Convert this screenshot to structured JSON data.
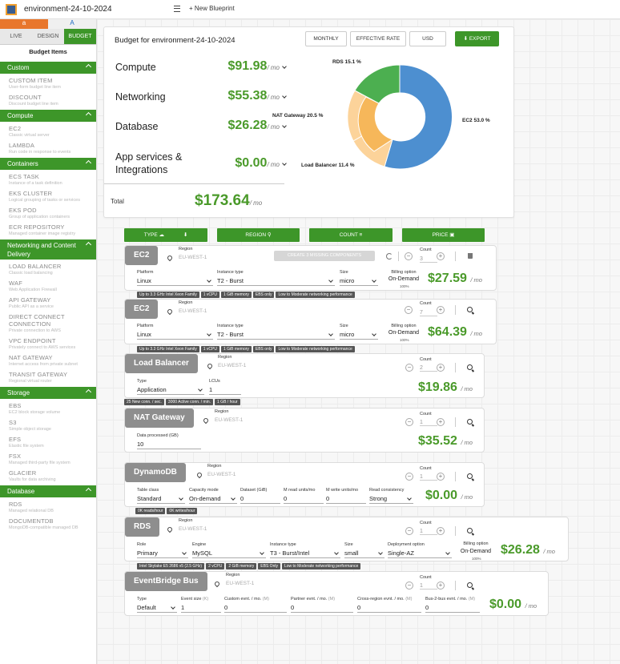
{
  "topbar": {
    "title": "environment-24-10-2024",
    "new_blueprint": "+ New Blueprint"
  },
  "sidebar": {
    "cloud_tabs": [
      "a",
      "A"
    ],
    "mode_tabs": [
      "LIVE",
      "DESIGN",
      "BUDGET"
    ],
    "title": "Budget Items",
    "groups": [
      {
        "label": "Custom",
        "items": [
          {
            "name": "CUSTOM ITEM",
            "desc": "User-form budget line item"
          },
          {
            "name": "DISCOUNT",
            "desc": "Discount budget line item"
          }
        ]
      },
      {
        "label": "Compute",
        "items": [
          {
            "name": "EC2",
            "desc": "Classic virtual server"
          },
          {
            "name": "LAMBDA",
            "desc": "Run code in response to events"
          }
        ]
      },
      {
        "label": "Containers",
        "items": [
          {
            "name": "ECS TASK",
            "desc": "Instance of a task definition"
          },
          {
            "name": "EKS CLUSTER",
            "desc": "Logical grouping of tasks or services"
          },
          {
            "name": "EKS POD",
            "desc": "Group of application containers"
          },
          {
            "name": "ECR REPOSITORY",
            "desc": "Managed container image registry"
          }
        ]
      },
      {
        "label": "Networking and Content Delivery",
        "items": [
          {
            "name": "LOAD BALANCER",
            "desc": "Classic load balancing"
          },
          {
            "name": "WAF",
            "desc": "Web Application Firewall"
          },
          {
            "name": "API GATEWAY",
            "desc": "Public API as a service"
          },
          {
            "name": "DIRECT CONNECT CONNECTION",
            "desc": "Private connection to AWS"
          },
          {
            "name": "VPC ENDPOINT",
            "desc": "Privately connect to AWS services"
          },
          {
            "name": "NAT GATEWAY",
            "desc": "Internet access from private subnet"
          },
          {
            "name": "TRANSIT GATEWAY",
            "desc": "Regional virtual router"
          }
        ]
      },
      {
        "label": "Storage",
        "items": [
          {
            "name": "EBS",
            "desc": "EC2 block storage volume"
          },
          {
            "name": "S3",
            "desc": "Simple object storage"
          },
          {
            "name": "EFS",
            "desc": "Elastic file system"
          },
          {
            "name": "FSX",
            "desc": "Managed third-party file system"
          },
          {
            "name": "GLACIER",
            "desc": "Vaults for data archiving"
          }
        ]
      },
      {
        "label": "Database",
        "items": [
          {
            "name": "RDS",
            "desc": "Managed relational DB"
          },
          {
            "name": "DOCUMENTDB",
            "desc": "MongoDB-compatible managed DB"
          }
        ]
      }
    ]
  },
  "budget": {
    "title": "Budget for environment-24-10-2024",
    "buttons": {
      "monthly": "MONTHLY",
      "effective_rate": "EFFECTIVE RATE",
      "currency": "USD",
      "export": "EXPORT"
    },
    "categories": [
      {
        "name": "Compute",
        "price": "$91.98",
        "unit": "/ mo"
      },
      {
        "name": "Networking",
        "price": "$55.38",
        "unit": "/ mo"
      },
      {
        "name": "Database",
        "price": "$26.28",
        "unit": "/ mo"
      },
      {
        "name": "App services & Integrations",
        "price": "$0.00",
        "unit": "/ mo"
      }
    ],
    "total_label": "Total",
    "total_value": "$173.64",
    "total_unit": "/ mo",
    "pie_labels": {
      "rds": "RDS 15.1 %",
      "nat": "NAT Gateway 20.5 %",
      "lb": "Load Balancer 11.4 %",
      "ec2": "EC2 53.0 %"
    },
    "colors": {
      "ec2": "#4d8fd0",
      "rds": "#4caf50",
      "nat": "#f6b75a",
      "lb": "#fcd39a",
      "accent": "#3d9629"
    }
  },
  "filters": [
    "TYPE",
    "REGION",
    "COUNT",
    "PRICE"
  ],
  "common": {
    "region_label": "Region",
    "region_value": "EU-WEST-1",
    "count_label": "Count",
    "unit": "/ mo",
    "billing_label": "Billing option",
    "billing_value": "On-Demand",
    "billing_pct": "100%"
  },
  "cards": {
    "ec2a": {
      "tag": "EC2",
      "missing": "CREATE 3 MISSING COMPONENTS",
      "count": "3",
      "fields": {
        "platform_l": "Platform",
        "platform": "Linux",
        "itype_l": "Instance type",
        "itype": "T2 - Burst",
        "size_l": "Size",
        "size": "micro"
      },
      "price": "$27.59",
      "chips": [
        "Up to 3.3 GHz Intel Xeon Family",
        "1 vCPU",
        "1 GiB memory",
        "EBS only",
        "Low to Moderate networking performance"
      ]
    },
    "ec2b": {
      "tag": "EC2",
      "count": "7",
      "fields": {
        "platform_l": "Platform",
        "platform": "Linux",
        "itype_l": "Instance type",
        "itype": "T2 - Burst",
        "size_l": "Size",
        "size": "micro"
      },
      "price": "$64.39",
      "chips": [
        "Up to 3.3 GHz Intel Xeon Family",
        "1 vCPU",
        "1 GiB memory",
        "EBS only",
        "Low to Moderate networking performance"
      ]
    },
    "lb": {
      "tag": "Load Balancer",
      "count": "2",
      "fields": {
        "type_l": "Type",
        "type": "Application",
        "lcus_l": "LCUs",
        "lcus": "1"
      },
      "price": "$19.86",
      "chips": [
        "25 New conn. / sec.",
        "3000 Active conn. / min.",
        "1 GB / hour"
      ]
    },
    "nat": {
      "tag": "NAT Gateway",
      "count": "1",
      "fields": {
        "data_l": "Data processed (GB)",
        "data": "10"
      },
      "price": "$35.52"
    },
    "ddb": {
      "tag": "DynamoDB",
      "count": "1",
      "fields": {
        "tc_l": "Table class",
        "tc": "Standard",
        "cm_l": "Capacity mode",
        "cm": "On-demand",
        "ds_l": "Dataset (GiB)",
        "ds": "0",
        "mr_l": "M read units/mo",
        "mr": "0",
        "mw_l": "M write units/mo",
        "mw": "0",
        "rc_l": "Read consistency",
        "rc": "Strong"
      },
      "price": "$0.00",
      "chips": [
        "0K reads/hour",
        "0K writes/hour"
      ]
    },
    "rds": {
      "tag": "RDS",
      "count": "1",
      "fields": {
        "role_l": "Role",
        "role": "Primary",
        "engine_l": "Engine",
        "engine": "MySQL",
        "itype_l": "Instance type",
        "itype": "T3 - Burst/Intel",
        "size_l": "Size",
        "size": "small",
        "dep_l": "Deployment option",
        "dep": "Single-AZ"
      },
      "price": "$26.28",
      "chips": [
        "Intel Skylake E5 2686 v5 (2.5 GHz)",
        "2 vCPU",
        "2 GiB memory",
        "EBS Only",
        "Low to Moderate networking performance"
      ]
    },
    "eb": {
      "tag": "EventBridge Bus",
      "count": "1",
      "fields": {
        "type_l": "Type",
        "type": "Default",
        "es_l": "Event size",
        "es_unit": "(K)",
        "es": "1",
        "ce_l": "Custom evnt. / mo.",
        "ce": "0",
        "pe_l": "Partner evnt. / mo.",
        "pe": "0",
        "cr_l": "Cross-region evnt. / mo.",
        "cr": "0",
        "bb_l": "Bus-2-bus evnt. / mo.",
        "bb": "0",
        "m_unit": "(M)"
      },
      "price": "$0.00"
    }
  }
}
